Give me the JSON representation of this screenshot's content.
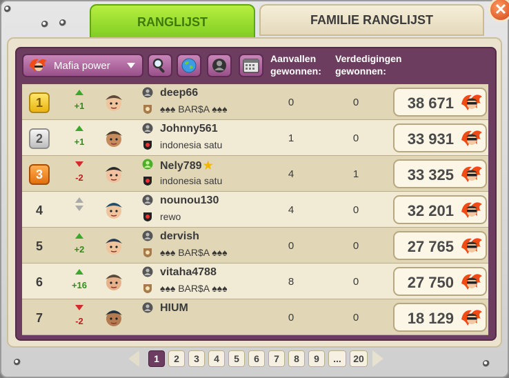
{
  "tabs": [
    {
      "label": "RANGLIJST",
      "active": true
    },
    {
      "label": "FAMILIE RANGLIJST",
      "active": false
    }
  ],
  "toolbar": {
    "dropdown_label": "Mafia power",
    "col_attacks": "Aanvallen gewonnen:",
    "col_defenses": "Verdedigingen gewonnen:"
  },
  "rows": [
    {
      "rank": "1",
      "rank_style": "gold",
      "trend": "up",
      "delta": "+1",
      "name": "deep66",
      "star": false,
      "family": "♠♠♠ BAR$A ♠♠♠",
      "attacks": "0",
      "defenses": "0",
      "power": "38 671"
    },
    {
      "rank": "2",
      "rank_style": "silver",
      "trend": "up",
      "delta": "+1",
      "name": "Johnny561",
      "star": false,
      "family": "indonesia satu",
      "attacks": "1",
      "defenses": "0",
      "power": "33 931"
    },
    {
      "rank": "3",
      "rank_style": "bronze",
      "trend": "down",
      "delta": "-2",
      "name": "Nely789",
      "star": true,
      "family": "indonesia satu",
      "attacks": "4",
      "defenses": "1",
      "power": "33 325"
    },
    {
      "rank": "4",
      "rank_style": "plain",
      "trend": "same",
      "delta": "",
      "name": "nounou130",
      "star": false,
      "family": "rewo",
      "attacks": "4",
      "defenses": "0",
      "power": "32 201"
    },
    {
      "rank": "5",
      "rank_style": "plain",
      "trend": "up",
      "delta": "+2",
      "name": "dervish",
      "star": false,
      "family": "♠♠♠ BAR$A ♠♠♠",
      "attacks": "0",
      "defenses": "0",
      "power": "27 765"
    },
    {
      "rank": "6",
      "rank_style": "plain",
      "trend": "up",
      "delta": "+16",
      "name": "vitaha4788",
      "star": false,
      "family": "♠♠♠ BAR$A ♠♠♠",
      "attacks": "8",
      "defenses": "0",
      "power": "27 750"
    },
    {
      "rank": "7",
      "rank_style": "plain",
      "trend": "down",
      "delta": "-2",
      "name": "HIUM",
      "star": false,
      "family": "",
      "attacks": "0",
      "defenses": "0",
      "power": "18 129"
    }
  ],
  "pagination": {
    "pages": [
      "1",
      "2",
      "3",
      "4",
      "5",
      "6",
      "7",
      "8",
      "9",
      "...",
      "20"
    ],
    "current": "1"
  },
  "colors": {
    "active_tab": "#6fc21a",
    "panel_purple": "#6c3d5f",
    "row_light": "#f1ead5",
    "row_dark": "#e1d7b7"
  }
}
